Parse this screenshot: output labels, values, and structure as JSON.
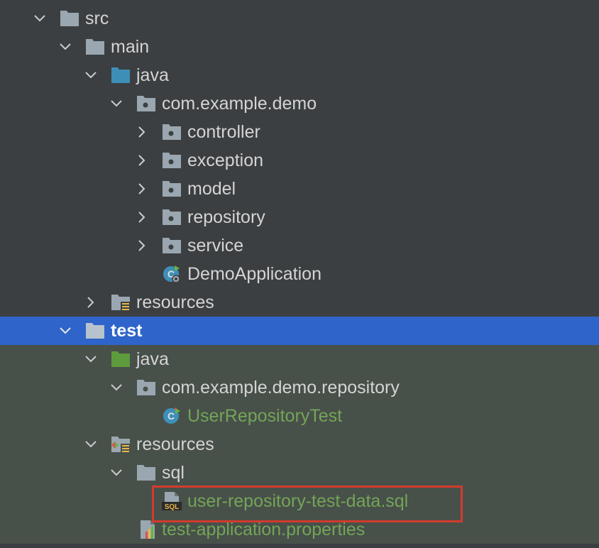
{
  "tree": {
    "src_label": "src",
    "main_label": "main",
    "main_java_label": "java",
    "package_label": "com.example.demo",
    "controller_label": "controller",
    "exception_label": "exception",
    "model_label": "model",
    "repository_label": "repository",
    "service_label": "service",
    "demo_app_label": "DemoApplication",
    "main_resources_label": "resources",
    "test_label": "test",
    "test_java_label": "java",
    "test_package_label": "com.example.demo.repository",
    "user_repo_test_label": "UserRepositoryTest",
    "test_resources_label": "resources",
    "sql_folder_label": "sql",
    "sql_file_label": "user-repository-test-data.sql",
    "properties_file_label": "test-application.properties",
    "sql_badge": "SQL"
  },
  "colors": {
    "background": "#3c3f41",
    "test_background": "#48504a",
    "selection": "#2f65ca",
    "green_text": "#73a556",
    "highlight_border": "#d33a2c",
    "folder_gray": "#9aa7b0",
    "folder_blue": "#3d8fb8",
    "folder_green": "#5e9b3c"
  },
  "icons": {
    "folder": "folder-icon",
    "package": "package-icon",
    "source_root": "source-root-folder-icon",
    "test_root": "test-source-root-folder-icon",
    "resources": "resources-folder-icon",
    "test_resources": "test-resources-folder-icon",
    "spring_class": "spring-boot-class-icon",
    "test_class": "test-class-icon",
    "sql_file": "sql-file-icon",
    "properties_file": "properties-file-icon"
  }
}
